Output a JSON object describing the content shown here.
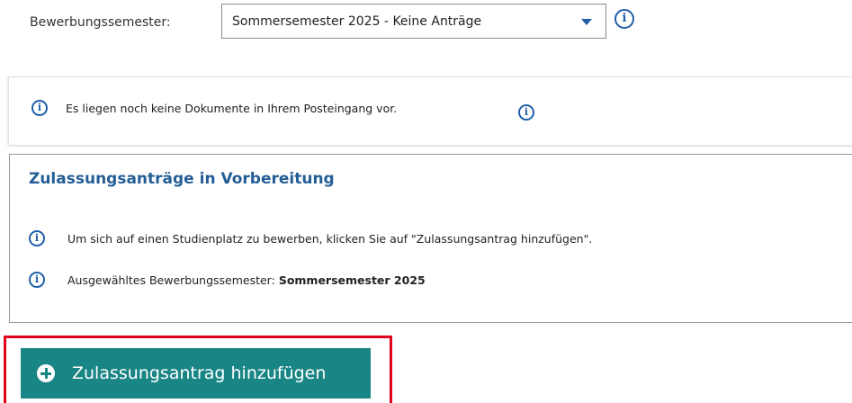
{
  "semester": {
    "label": "Bewerbungssemester:",
    "selected": "Sommersemester 2025 - Keine Anträge",
    "info_icon": "info-icon"
  },
  "inbox": {
    "icon": "info-icon",
    "message": "Es liegen noch keine Dokumente in Ihrem Posteingang vor."
  },
  "preparation": {
    "title": "Zulassungsanträge in Vorbereitung",
    "hint": "Um sich auf einen Studienplatz zu bewerben, klicken Sie auf \"Zulassungsantrag hinzufügen\".",
    "selected_semester_label": "Ausgewähltes Bewerbungssemester:",
    "selected_semester_value": "Sommersemester 2025"
  },
  "actions": {
    "add_application_label": "Zulassungsantrag hinzufügen",
    "add_application_icon": "plus-circle-icon"
  },
  "colors": {
    "accent_blue": "#1f5fa8",
    "title_blue": "#245e96",
    "button_teal": "#1a8585",
    "highlight_red": "#e0001b"
  }
}
